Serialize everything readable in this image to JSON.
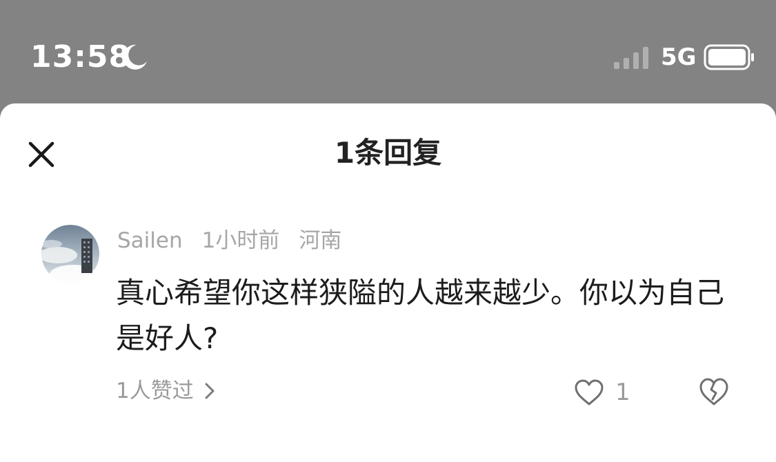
{
  "status_bar": {
    "time": "13:58",
    "network": "5G",
    "icons": [
      "moon-icon",
      "signal-icon",
      "battery-icon"
    ]
  },
  "sheet": {
    "title": "1条回复",
    "close_icon": "close-icon"
  },
  "comment": {
    "username": "Sailen",
    "time_ago": "1小时前",
    "location": "河南",
    "text": "真心希望你这样狭隘的人越来越少。你以为自己是好人?",
    "likers_text": "1人赞过",
    "like_count": "1",
    "icons": [
      "avatar",
      "chevron-right-icon",
      "heart-icon",
      "broken-heart-icon"
    ]
  },
  "colors": {
    "status_bar_background": "#838383",
    "sheet_background": "#ffffff",
    "primary_text": "#1c1c1c",
    "secondary_text": "#a6a6a6"
  }
}
